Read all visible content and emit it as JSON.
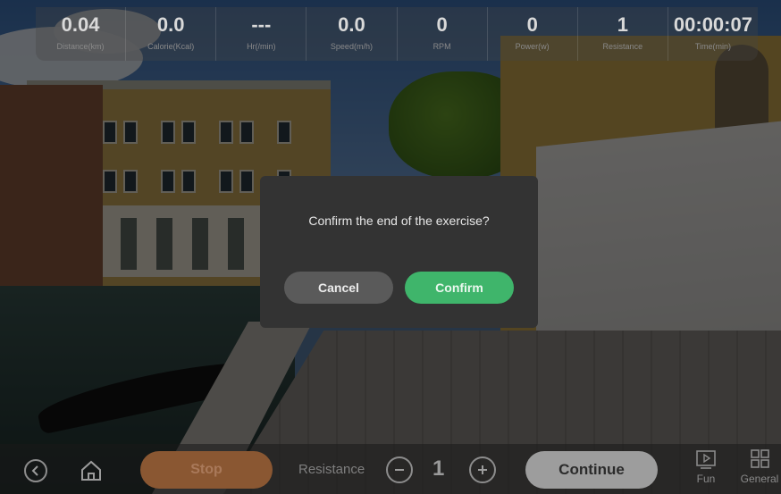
{
  "stats": [
    {
      "value": "0.04",
      "label": "Distance(km)"
    },
    {
      "value": "0.0",
      "label": "Calorie(Kcal)"
    },
    {
      "value": "---",
      "label": "Hr(/min)"
    },
    {
      "value": "0.0",
      "label": "Speed(m/h)"
    },
    {
      "value": "0",
      "label": "RPM"
    },
    {
      "value": "0",
      "label": "Power(w)"
    },
    {
      "value": "1",
      "label": "Resistance"
    },
    {
      "value": "00:00:07",
      "label": "Time(min)"
    }
  ],
  "dialog": {
    "message": "Confirm the end of the exercise?",
    "cancel_label": "Cancel",
    "confirm_label": "Confirm"
  },
  "controls": {
    "stop_label": "Stop",
    "resistance_label": "Resistance",
    "resistance_value": "1",
    "continue_label": "Continue",
    "fun_label": "Fun",
    "general_label": "General"
  },
  "icons": {
    "back": "back-icon",
    "home": "home-icon",
    "minus": "minus-icon",
    "plus": "plus-icon",
    "fun": "fun-icon",
    "general": "grid-icon"
  },
  "colors": {
    "confirm": "#3fb56b",
    "stop": "#8a5732",
    "continue": "#9d9d9d",
    "dialog_bg": "#333333"
  }
}
